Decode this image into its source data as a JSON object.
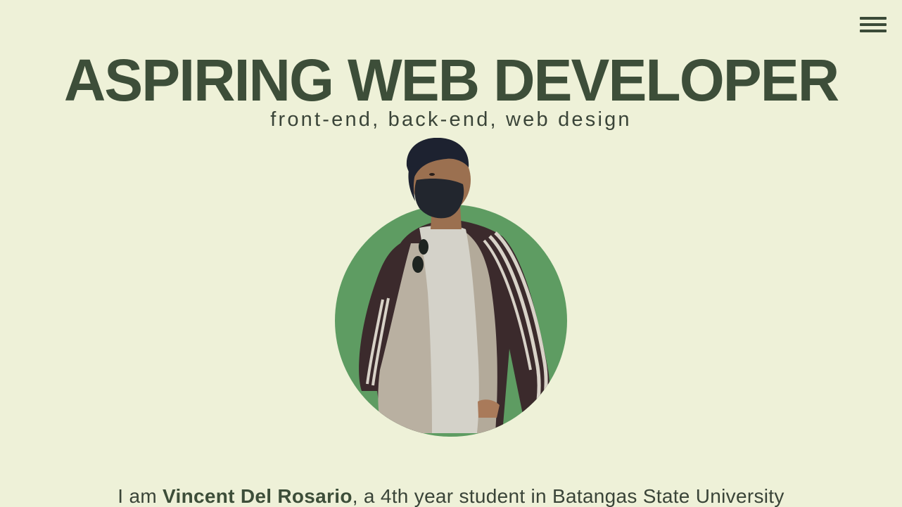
{
  "nav": {
    "menu_icon": "hamburger-menu-icon"
  },
  "hero": {
    "title": "ASPIRING WEB DEVELOPER",
    "subtitle": "front-end, back-end, web design"
  },
  "portrait": {
    "accent_color": "#5e9c62",
    "image_label": "photo of person wearing face mask and track jacket"
  },
  "intro": {
    "prefix": "I am ",
    "name": "Vincent Del Rosario",
    "suffix": ", a 4th year student in Batangas State University"
  },
  "colors": {
    "background": "#eef1d8",
    "heading": "#3d4e39",
    "circle": "#5e9c62"
  }
}
